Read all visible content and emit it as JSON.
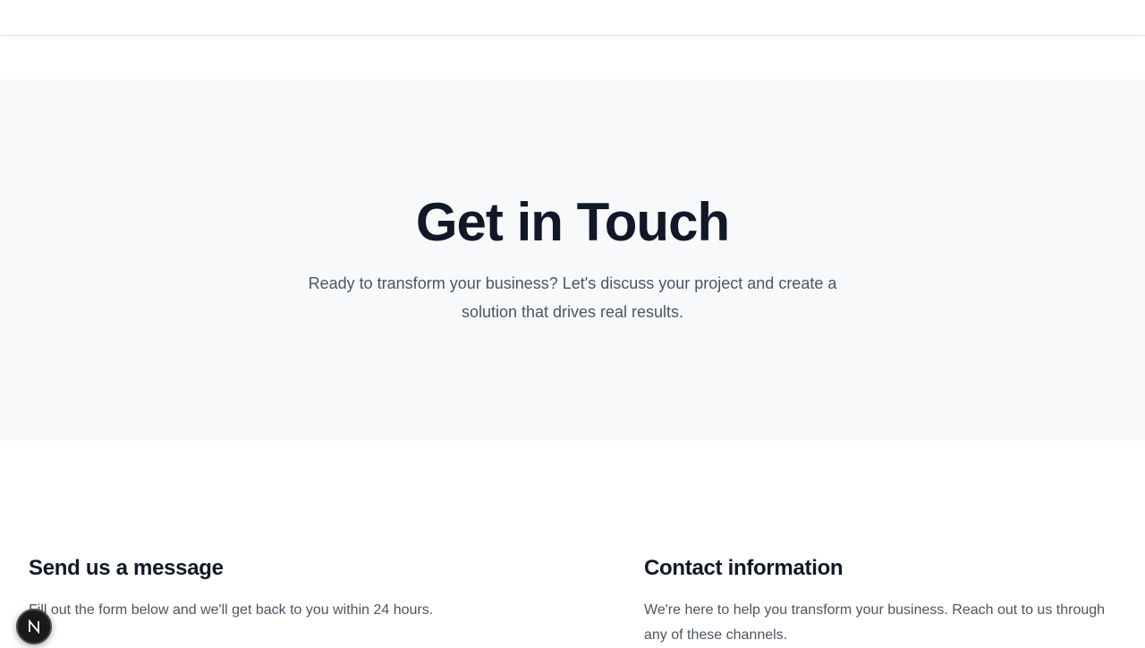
{
  "hero": {
    "title": "Get in Touch",
    "subtitle": "Ready to transform your business? Let's discuss your project and create a solution that drives real results."
  },
  "message_section": {
    "heading": "Send us a message",
    "description": "Fill out the form below and we'll get back to you within 24 hours."
  },
  "contact_section": {
    "heading": "Contact information",
    "description": "We're here to help you transform your business. Reach out to us through any of these channels."
  },
  "dev_badge": {
    "icon": "nextjs-n-icon",
    "colors": {
      "background": "#1a1a1a",
      "border": "#4a4a4a",
      "glyph": "#ffffff"
    }
  },
  "colors": {
    "hero_background": "#f8f9fb",
    "heading": "#111827",
    "body_text": "#4b5563"
  }
}
